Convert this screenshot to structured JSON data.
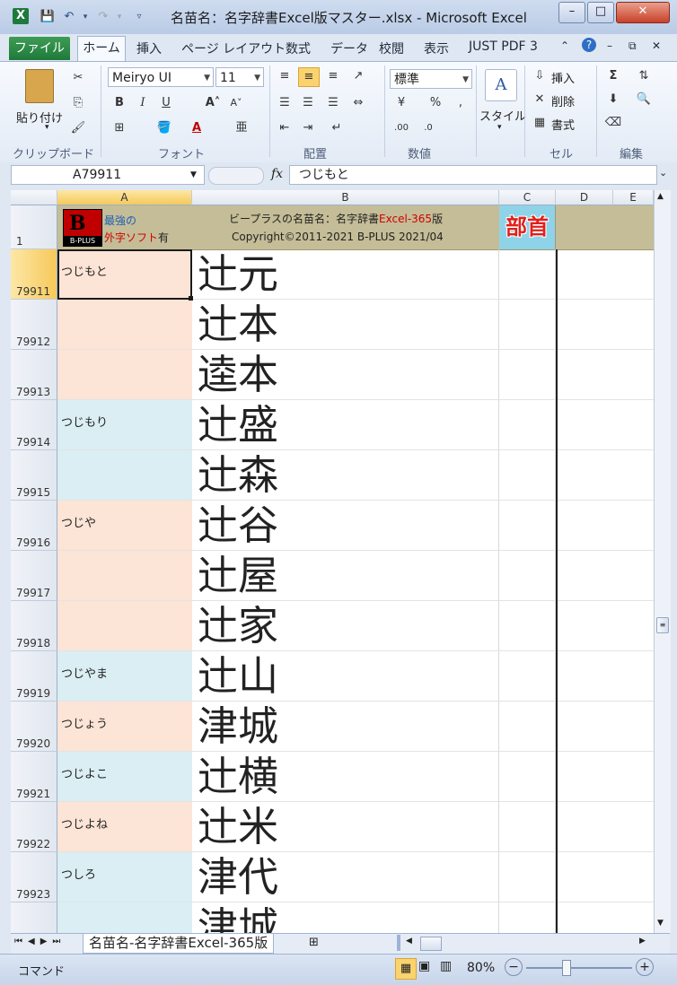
{
  "window": {
    "title": "名苗名：名字辞書Excel版マスター.xlsx - Microsoft Excel"
  },
  "tabs": [
    "ファイル",
    "ホーム",
    "挿入",
    "ページ レイアウト",
    "数式",
    "データ",
    "校閲",
    "表示",
    "JUST PDF 3"
  ],
  "ribbon": {
    "paste_label": "貼り付け",
    "font_name": "Meiryo UI",
    "font_size": "11",
    "number_format": "標準",
    "style_label": "スタイル",
    "insert_label": "挿入",
    "delete_label": "削除",
    "format_label": "書式",
    "groups": [
      "クリップボード",
      "フォント",
      "配置",
      "数値",
      "セル",
      "編集"
    ]
  },
  "formula_bar": {
    "cell_ref": "A79911",
    "fx": "fx",
    "content": "つじもと"
  },
  "columns": [
    "A",
    "B",
    "C",
    "D",
    "E"
  ],
  "header_row": {
    "row_number": "1",
    "logo_text": "B-PLUS",
    "promo_line1": "最強の",
    "promo_line2a": "外字ソフト",
    "promo_line2b": "有",
    "title_prefix": "ビープラスの名苗名：名字辞書",
    "title_accent": "Excel-365",
    "title_suffix": "版",
    "copyright": "Copyright©2011-2021 B-PLUS 2021/04",
    "bushu": "部首"
  },
  "rows": [
    {
      "num": "79911",
      "reading": "つじもと",
      "kanji": "辻元",
      "bg": "#fce4d6"
    },
    {
      "num": "79912",
      "reading": "",
      "kanji": "辻本",
      "bg": "#fce4d6"
    },
    {
      "num": "79913",
      "reading": "",
      "kanji": "逵本",
      "bg": "#fce4d6"
    },
    {
      "num": "79914",
      "reading": "つじもり",
      "kanji": "辻盛",
      "bg": "#daeef3"
    },
    {
      "num": "79915",
      "reading": "",
      "kanji": "辻森",
      "bg": "#daeef3"
    },
    {
      "num": "79916",
      "reading": "つじや",
      "kanji": "辻谷",
      "bg": "#fce4d6"
    },
    {
      "num": "79917",
      "reading": "",
      "kanji": "辻屋",
      "bg": "#fce4d6"
    },
    {
      "num": "79918",
      "reading": "",
      "kanji": "辻家",
      "bg": "#fce4d6"
    },
    {
      "num": "79919",
      "reading": "つじやま",
      "kanji": "辻山",
      "bg": "#daeef3"
    },
    {
      "num": "79920",
      "reading": "つじょう",
      "kanji": "津城",
      "bg": "#fce4d6"
    },
    {
      "num": "79921",
      "reading": "つじよこ",
      "kanji": "辻横",
      "bg": "#daeef3"
    },
    {
      "num": "79922",
      "reading": "つじよね",
      "kanji": "辻米",
      "bg": "#fce4d6"
    },
    {
      "num": "79923",
      "reading": "つしろ",
      "kanji": "津代",
      "bg": "#daeef3"
    },
    {
      "num": "",
      "reading": "",
      "kanji": "津城",
      "bg": "#daeef3"
    }
  ],
  "sheet_tab": "名苗名-名字辞書Excel-365版",
  "status": {
    "mode": "コマンド",
    "zoom": "80%"
  }
}
